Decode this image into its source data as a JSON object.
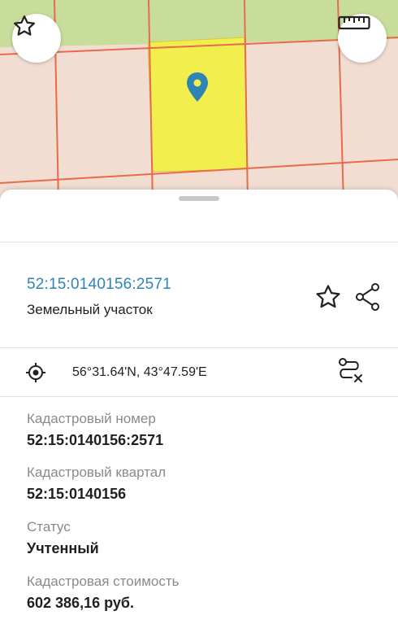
{
  "object": {
    "cadastral_number": "52:15:0140156:2571",
    "type": "Земельный участок"
  },
  "location": {
    "coordinates": "56°31.64'N, 43°47.59'E"
  },
  "details": [
    {
      "label": "Кадастровый номер",
      "value": "52:15:0140156:2571"
    },
    {
      "label": "Кадастровый квартал",
      "value": "52:15:0140156"
    },
    {
      "label": "Статус",
      "value": "Учтенный"
    },
    {
      "label": "Кадастровая стоимость",
      "value": "602 386,16 руб."
    }
  ],
  "colors": {
    "accent": "#2f84b6",
    "selected_parcel": "#f2ee4e",
    "parcel_border": "#e86a4d",
    "map_green": "#c9dd9b",
    "map_land": "#f2ddd2"
  },
  "icons": {
    "map_left_button": "star-outline-icon",
    "map_right_button": "ruler-icon",
    "marker": "map-pin-icon",
    "favorite": "star-outline-icon",
    "share": "share-icon",
    "locate": "gps-target-icon",
    "route": "route-clear-icon"
  }
}
